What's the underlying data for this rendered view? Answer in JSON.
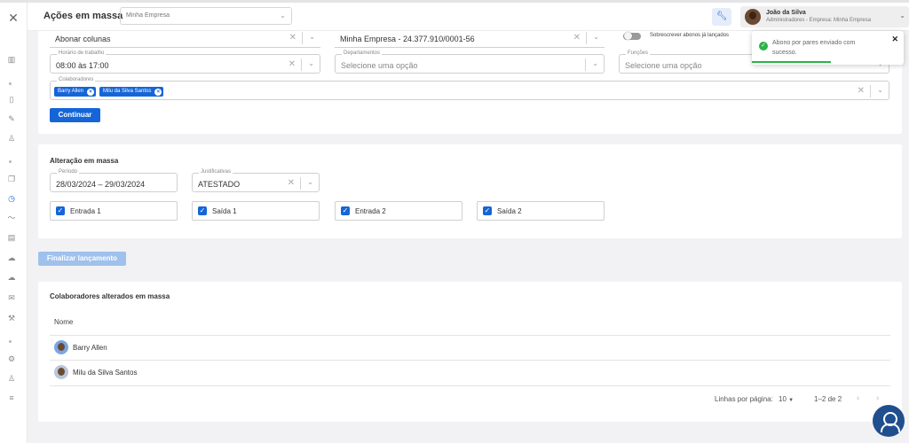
{
  "header": {
    "title": "Ações em massa",
    "company_select": "Minha Empresa",
    "user_name": "João da Silva",
    "user_role": "Administradores - Empresa: Minha Empresa"
  },
  "form": {
    "abonar": {
      "value": "Abonar colunas"
    },
    "empresa": {
      "value": "Minha Empresa - 24.377.910/0001-56"
    },
    "sobrescrever_label": "Sobrescrever abonos já lançados",
    "sobrescrever_on": false,
    "horario": {
      "label": "Horário de trabalho",
      "value": "08:00 às 17:00"
    },
    "departamentos": {
      "label": "Departamentos",
      "placeholder": "Selecione uma opção"
    },
    "funcoes": {
      "label": "Funções",
      "placeholder": "Selecione uma opção"
    },
    "colaboradores": {
      "label": "Colaboradores",
      "chips": [
        "Barry Allen",
        "Milu da Silva Santos"
      ]
    },
    "continuar_label": "Continuar"
  },
  "alteracao": {
    "title": "Alteração em massa",
    "periodo": {
      "label": "Período",
      "value": "28/03/2024 – 29/03/2024"
    },
    "justificativas": {
      "label": "Justificativas",
      "value": "ATESTADO"
    },
    "checkboxes": [
      {
        "label": "Entrada 1",
        "checked": true
      },
      {
        "label": "Saída 1",
        "checked": true
      },
      {
        "label": "Entrada 2",
        "checked": true
      },
      {
        "label": "Saída 2",
        "checked": true
      }
    ]
  },
  "finalizar_label": "Finalizar lançamento",
  "table": {
    "title": "Colaboradores alterados em massa",
    "header_nome": "Nome",
    "rows": [
      "Barry Allen",
      "Milu da Silva Santos"
    ],
    "rows_per_page_label": "Linhas por página:",
    "rows_per_page": "10",
    "range": "1–2 de 2"
  },
  "toast": {
    "message": "Abono por pares enviado com sucesso.",
    "progress": 0.52
  },
  "colors": {
    "primary": "#1565d8",
    "success": "#2db34a",
    "disabled": "#9fc1ec"
  }
}
